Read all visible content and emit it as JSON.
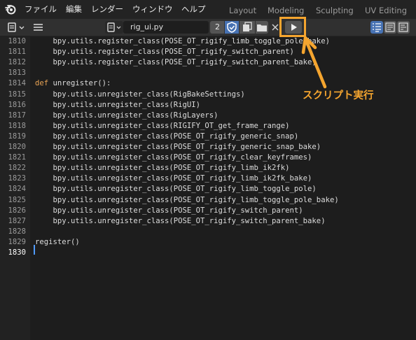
{
  "topbar": {
    "menus": [
      "ファイル",
      "編集",
      "レンダー",
      "ウィンドウ",
      "ヘルプ"
    ],
    "workspaces": [
      "Layout",
      "Modeling",
      "Sculpting",
      "UV Editing"
    ]
  },
  "header": {
    "file_name": "rig_ui.py",
    "users_count": "2"
  },
  "annotation": {
    "label": "スクリプト実行",
    "color": "#f5a52f"
  },
  "editor": {
    "lines": [
      {
        "num": "1810",
        "code": "    bpy.utils.register_class(POSE_OT_rigify_limb_toggle_pole_bake)"
      },
      {
        "num": "1811",
        "code": "    bpy.utils.register_class(POSE_OT_rigify_switch_parent)"
      },
      {
        "num": "1812",
        "code": "    bpy.utils.register_class(POSE_OT_rigify_switch_parent_bake)"
      },
      {
        "num": "1813",
        "code": ""
      },
      {
        "num": "1814",
        "code": "def unregister():"
      },
      {
        "num": "1815",
        "code": "    bpy.utils.unregister_class(RigBakeSettings)"
      },
      {
        "num": "1816",
        "code": "    bpy.utils.unregister_class(RigUI)"
      },
      {
        "num": "1817",
        "code": "    bpy.utils.unregister_class(RigLayers)"
      },
      {
        "num": "1818",
        "code": "    bpy.utils.unregister_class(RIGIFY_OT_get_frame_range)"
      },
      {
        "num": "1819",
        "code": "    bpy.utils.unregister_class(POSE_OT_rigify_generic_snap)"
      },
      {
        "num": "1820",
        "code": "    bpy.utils.unregister_class(POSE_OT_rigify_generic_snap_bake)"
      },
      {
        "num": "1821",
        "code": "    bpy.utils.unregister_class(POSE_OT_rigify_clear_keyframes)"
      },
      {
        "num": "1822",
        "code": "    bpy.utils.unregister_class(POSE_OT_rigify_limb_ik2fk)"
      },
      {
        "num": "1823",
        "code": "    bpy.utils.unregister_class(POSE_OT_rigify_limb_ik2fk_bake)"
      },
      {
        "num": "1824",
        "code": "    bpy.utils.unregister_class(POSE_OT_rigify_limb_toggle_pole)"
      },
      {
        "num": "1825",
        "code": "    bpy.utils.unregister_class(POSE_OT_rigify_limb_toggle_pole_bake)"
      },
      {
        "num": "1826",
        "code": "    bpy.utils.unregister_class(POSE_OT_rigify_switch_parent)"
      },
      {
        "num": "1827",
        "code": "    bpy.utils.unregister_class(POSE_OT_rigify_switch_parent_bake)"
      },
      {
        "num": "1828",
        "code": ""
      },
      {
        "num": "1829",
        "code": "register()"
      },
      {
        "num": "1830",
        "code": ""
      }
    ],
    "current_line": "1830"
  }
}
